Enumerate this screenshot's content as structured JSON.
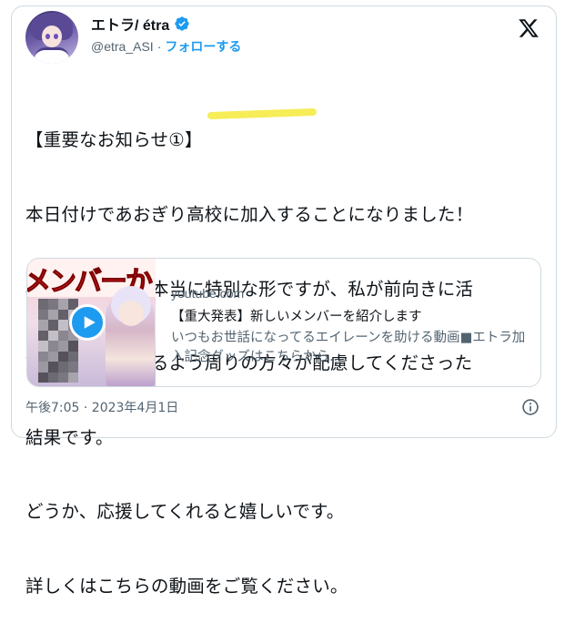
{
  "author": {
    "display_name": "エトラ/ étra",
    "handle": "@etra_ASI",
    "separator": "·",
    "follow_label": "フォローする"
  },
  "tweet": {
    "lines": [
      "【重要なお知らせ①】",
      "本日付けであおぎり高校に加入することになりました！",
      "期間限定という本当に特別な形ですが、私が前向きに活",
      "動を続けていけるよう周りの方々が配慮してくださった",
      "結果です。",
      "どうか、応援してくれると嬉しいです。",
      "詳しくはこちらの動画をご覧ください。"
    ],
    "timestamp": "午後7:05 · 2023年4月1日"
  },
  "link_card": {
    "thumbnail_text": "メンバーか",
    "domain": "youtube.com",
    "title": "【重大発表】新しいメンバーを紹介します",
    "description": "いつもお世話になってるエイレーンを助ける動画■エトラ加入記念グッズはこちらから..."
  },
  "icons": {
    "verified": "verified-badge-icon",
    "platform": "x-logo-icon",
    "play": "play-icon",
    "info": "info-icon"
  },
  "colors": {
    "accent": "#1d9bf0",
    "text": "#0f1419",
    "muted": "#536471",
    "border": "#cfd9de",
    "highlight": "#f5ea3a"
  }
}
